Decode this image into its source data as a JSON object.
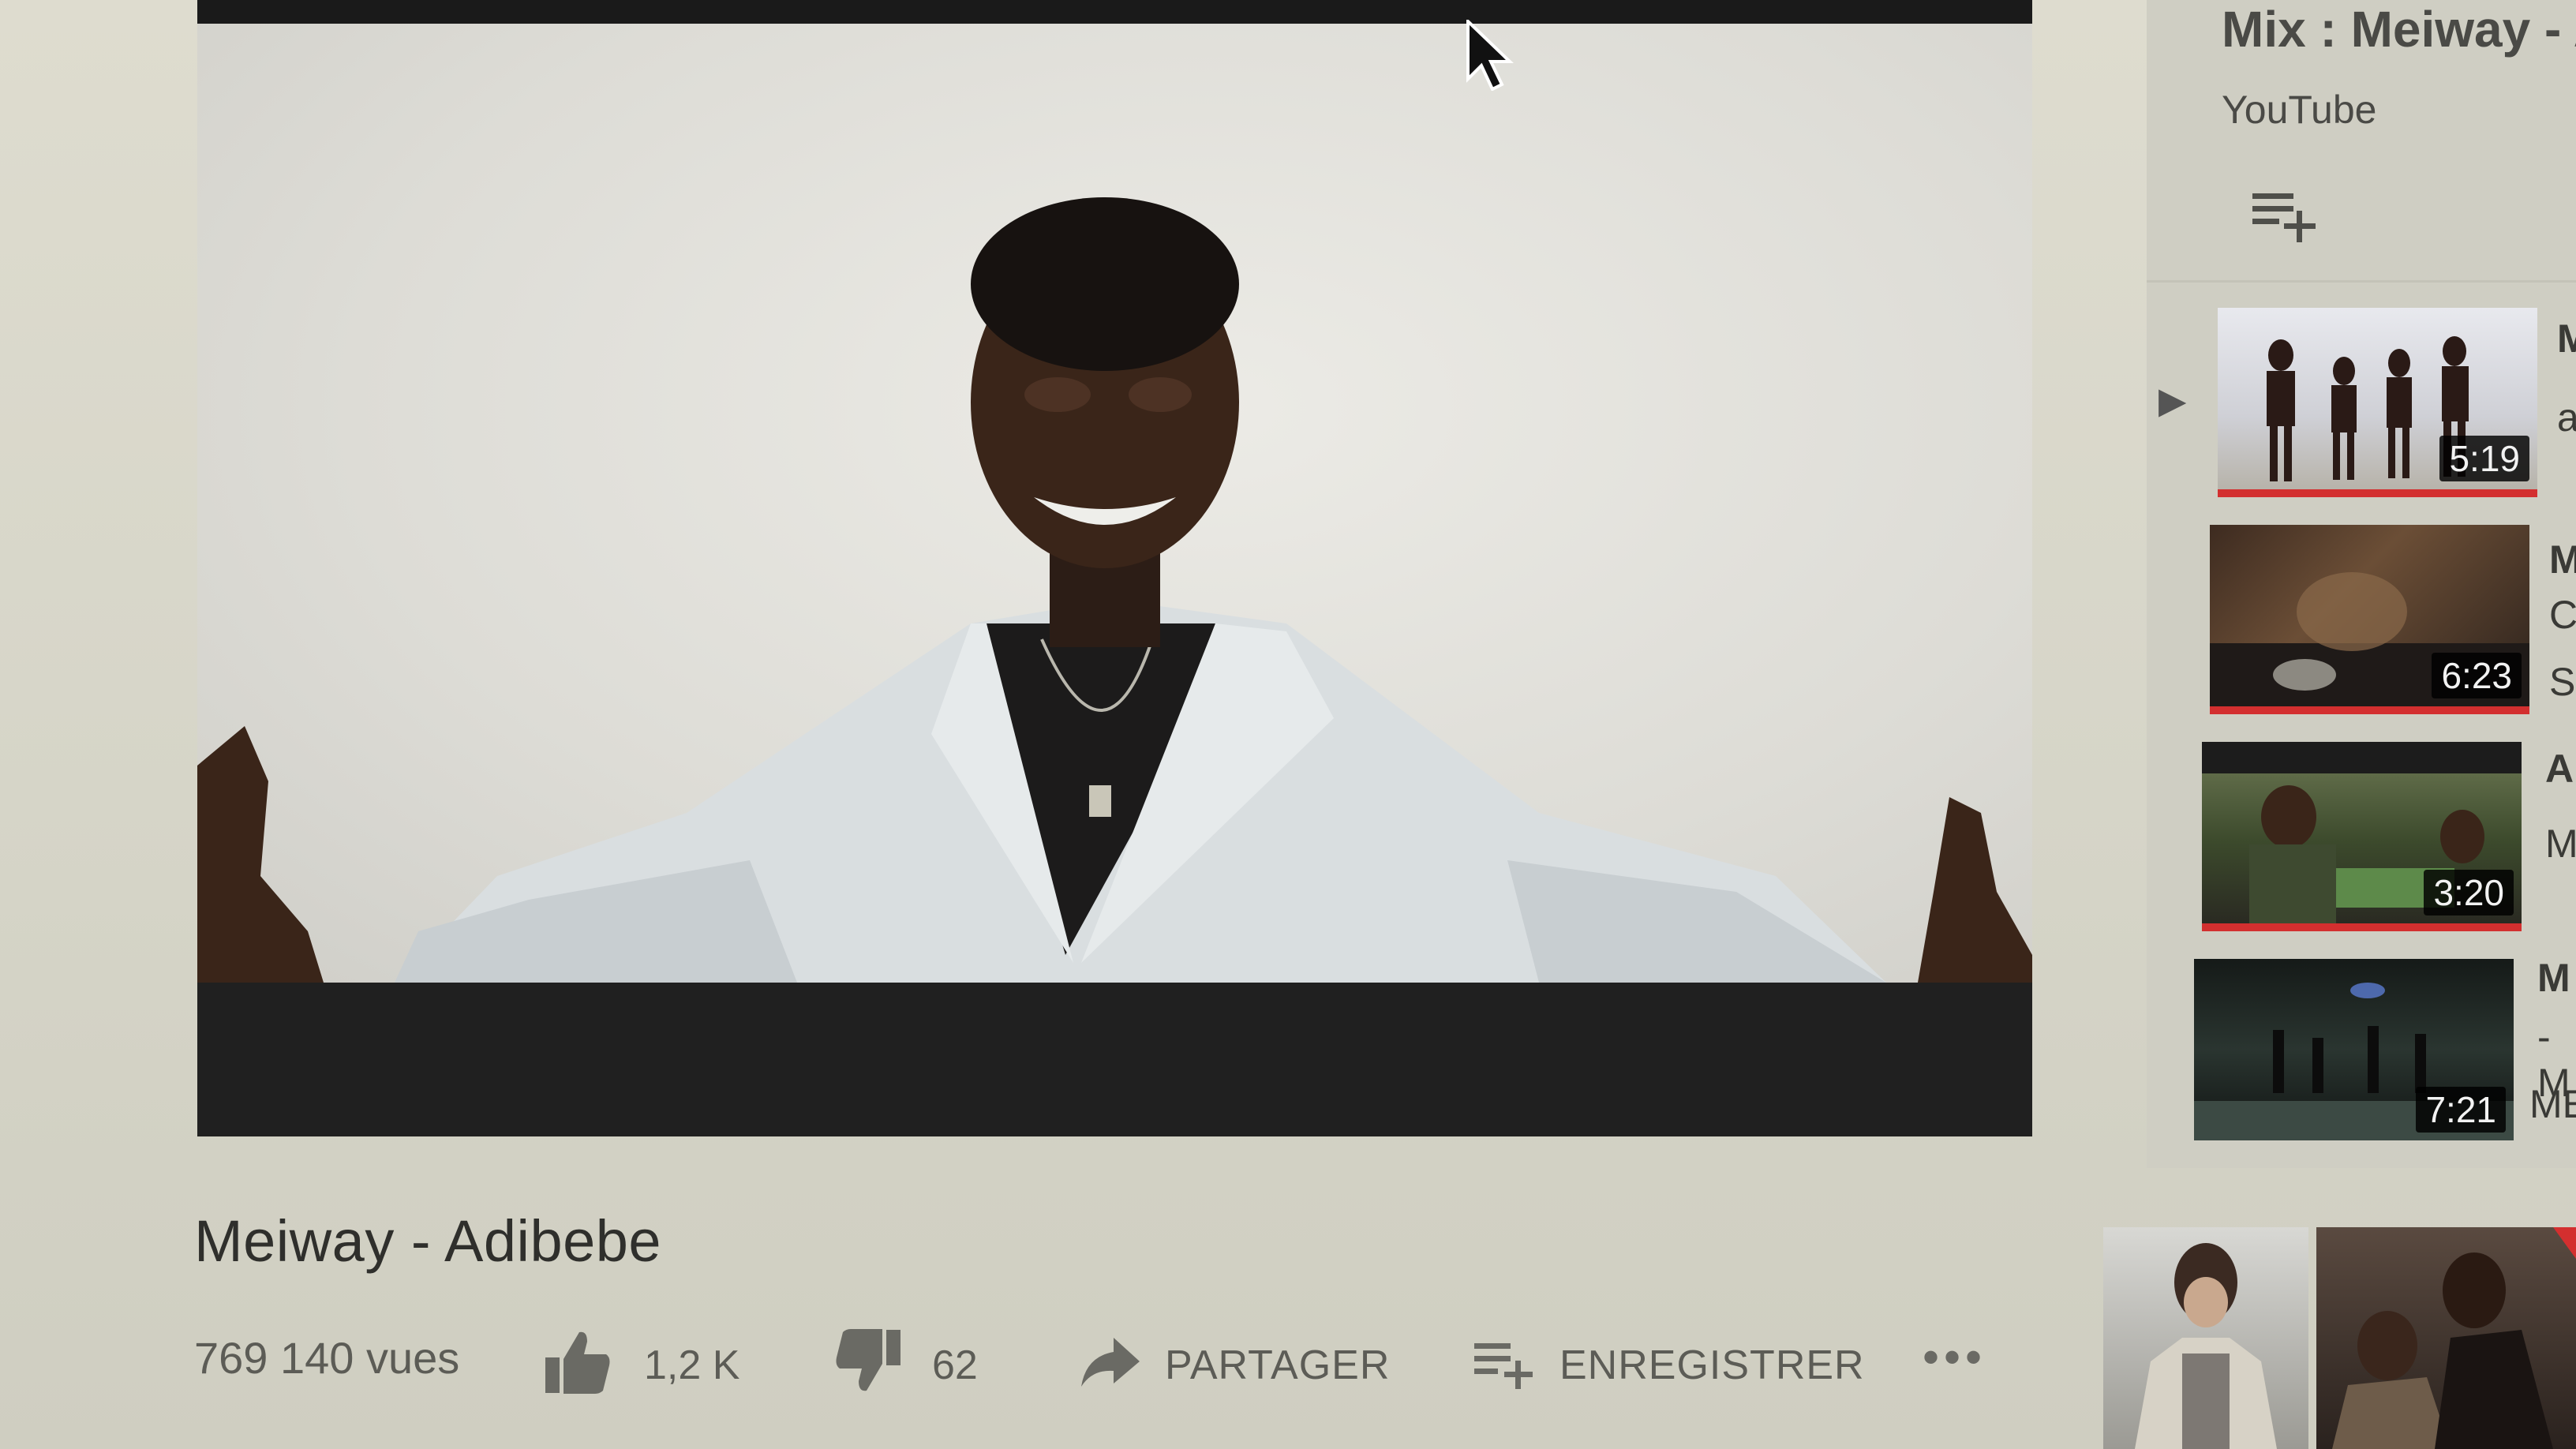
{
  "video": {
    "title": "Meiway - Adibebe",
    "views": "769 140 vues",
    "likes": "1,2 K",
    "dislikes": "62",
    "share_label": "PARTAGER",
    "save_label": "ENREGISTRER"
  },
  "sidebar": {
    "mix_title": "Mix : Meiway - A",
    "mix_source": "YouTube",
    "items": [
      {
        "duration": "5:19",
        "title_fragment": "M",
        "subtitle_fragment": "a"
      },
      {
        "duration": "6:23",
        "title_fragment": "M",
        "subtitle_fragment": "C",
        "extra_fragment": "S"
      },
      {
        "duration": "3:20",
        "title_fragment": "A",
        "subtitle_fragment": "M"
      },
      {
        "duration": "7:21",
        "title_fragment": "M",
        "subtitle_fragment": "- M",
        "extra_fragment": "ME"
      }
    ]
  },
  "colors": {
    "progress_red": "#d32f2f",
    "screen_background": "#dedccf"
  },
  "icons": [
    "cursor-icon",
    "thumbs-up-icon",
    "thumbs-down-icon",
    "share-icon",
    "playlist-add-icon",
    "more-icon",
    "play-indicator-icon"
  ]
}
